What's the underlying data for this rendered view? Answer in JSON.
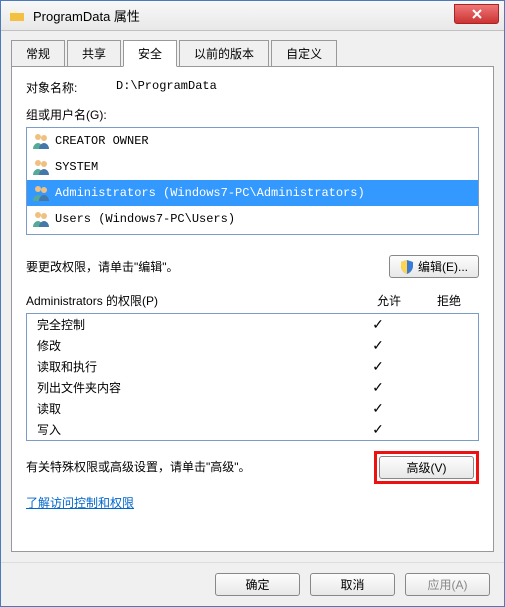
{
  "window": {
    "title": "ProgramData 属性"
  },
  "tabs": [
    "常规",
    "共享",
    "安全",
    "以前的版本",
    "自定义"
  ],
  "active_tab_index": 2,
  "object_name_label": "对象名称:",
  "object_name_value": "D:\\ProgramData",
  "groups_label": "组或用户名(G):",
  "groups": [
    {
      "name": "CREATOR OWNER",
      "selected": false
    },
    {
      "name": "SYSTEM",
      "selected": false
    },
    {
      "name": "Administrators (Windows7-PC\\Administrators)",
      "selected": true
    },
    {
      "name": "Users (Windows7-PC\\Users)",
      "selected": false
    }
  ],
  "edit_hint": "要更改权限，请单击\"编辑\"。",
  "edit_button": "编辑(E)...",
  "perm_title_prefix": "Administrators 的权限(P)",
  "perm_col_allow": "允许",
  "perm_col_deny": "拒绝",
  "permissions": [
    {
      "name": "完全控制",
      "allow": true,
      "deny": false
    },
    {
      "name": "修改",
      "allow": true,
      "deny": false
    },
    {
      "name": "读取和执行",
      "allow": true,
      "deny": false
    },
    {
      "name": "列出文件夹内容",
      "allow": true,
      "deny": false
    },
    {
      "name": "读取",
      "allow": true,
      "deny": false
    },
    {
      "name": "写入",
      "allow": true,
      "deny": false
    }
  ],
  "advanced_hint": "有关特殊权限或高级设置，请单击\"高级\"。",
  "advanced_button": "高级(V)",
  "learn_link": "了解访问控制和权限",
  "footer": {
    "ok": "确定",
    "cancel": "取消",
    "apply": "应用(A)"
  }
}
